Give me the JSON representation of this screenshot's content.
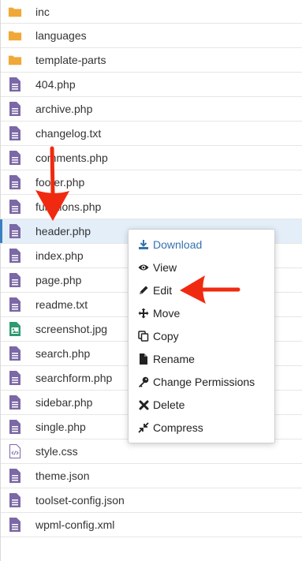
{
  "files": [
    {
      "name": "inc",
      "type": "folder"
    },
    {
      "name": "languages",
      "type": "folder"
    },
    {
      "name": "template-parts",
      "type": "folder"
    },
    {
      "name": "404.php",
      "type": "file"
    },
    {
      "name": "archive.php",
      "type": "file"
    },
    {
      "name": "changelog.txt",
      "type": "file"
    },
    {
      "name": "comments.php",
      "type": "file"
    },
    {
      "name": "footer.php",
      "type": "file"
    },
    {
      "name": "functions.php",
      "type": "file"
    },
    {
      "name": "header.php",
      "type": "file",
      "selected": true
    },
    {
      "name": "index.php",
      "type": "file"
    },
    {
      "name": "page.php",
      "type": "file"
    },
    {
      "name": "readme.txt",
      "type": "file"
    },
    {
      "name": "screenshot.jpg",
      "type": "image"
    },
    {
      "name": "search.php",
      "type": "file"
    },
    {
      "name": "searchform.php",
      "type": "file"
    },
    {
      "name": "sidebar.php",
      "type": "file"
    },
    {
      "name": "single.php",
      "type": "file"
    },
    {
      "name": "style.css",
      "type": "code"
    },
    {
      "name": "theme.json",
      "type": "file"
    },
    {
      "name": "toolset-config.json",
      "type": "file"
    },
    {
      "name": "wpml-config.xml",
      "type": "file"
    }
  ],
  "context_menu": {
    "items": [
      {
        "label": "Download",
        "icon": "download-icon"
      },
      {
        "label": "View",
        "icon": "eye-icon"
      },
      {
        "label": "Edit",
        "icon": "pencil-icon"
      },
      {
        "label": "Move",
        "icon": "move-arrows-icon"
      },
      {
        "label": "Copy",
        "icon": "copy-icon"
      },
      {
        "label": "Rename",
        "icon": "file-icon"
      },
      {
        "label": "Change Permissions",
        "icon": "key-icon"
      },
      {
        "label": "Delete",
        "icon": "x-icon"
      },
      {
        "label": "Compress",
        "icon": "compress-icon"
      }
    ]
  },
  "colors": {
    "folder": "#f0a838",
    "file": "#7b68a6",
    "image": "#2e9a6f",
    "selected_bg": "#e3eef9",
    "annotation_arrow": "#f02a10",
    "download_blue": "#3472b0"
  }
}
